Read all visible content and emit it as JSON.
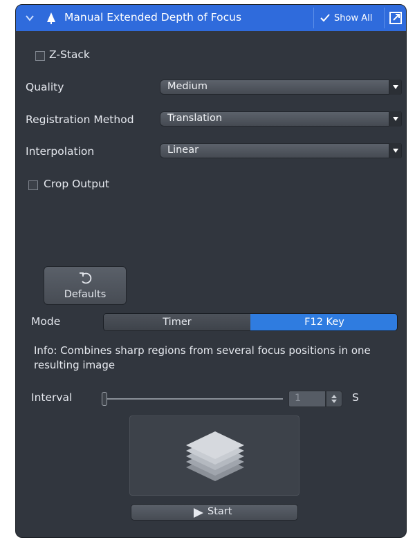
{
  "header": {
    "title": "Manual Extended Depth of Focus",
    "show_all": "Show All"
  },
  "z_stack": {
    "label": "Z-Stack",
    "checked": false
  },
  "fields": [
    {
      "label": "Quality",
      "value": "Medium"
    },
    {
      "label": "Registration Method",
      "value": "Translation"
    },
    {
      "label": "Interpolation",
      "value": "Linear"
    }
  ],
  "crop_output": {
    "label": "Crop Output",
    "checked": false
  },
  "defaults": {
    "label": "Defaults"
  },
  "mode": {
    "label": "Mode",
    "options": [
      "Timer",
      "F12 Key"
    ],
    "selected": "F12 Key"
  },
  "info": "Info: Combines sharp regions from several focus positions in one resulting image",
  "interval": {
    "label": "Interval",
    "value": "1",
    "unit": "S"
  },
  "start": {
    "label": "Start"
  },
  "colors": {
    "panel_bg": "#31363e",
    "header_bg": "#2f6bdc",
    "selected_segment": "#2f7ce0"
  },
  "icons": [
    "collapse-chevron-icon",
    "pin-icon",
    "checkmark-icon",
    "popout-icon",
    "undo-icon",
    "spin-arrows-icon",
    "zstack-layers-icon",
    "play-icon"
  ]
}
